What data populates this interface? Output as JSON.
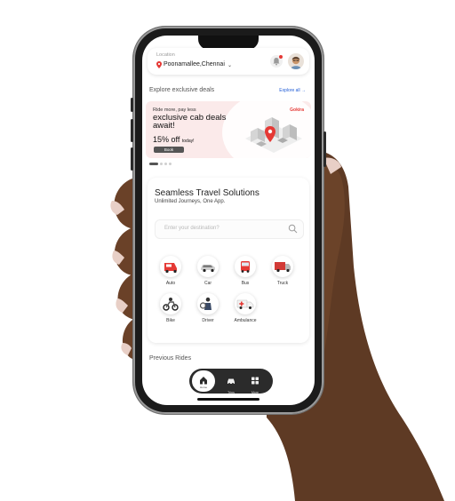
{
  "location": {
    "label": "Location",
    "name": "Poonamallee,Chennai"
  },
  "explore": {
    "title": "Explore exclusive deals",
    "link": "Explore all →"
  },
  "banner": {
    "subtitle": "Ride more, pay less",
    "title": "exclusive cab deals await!",
    "offer": "15% off",
    "offer_suffix": "today!",
    "button": "Book",
    "brand": "Gokira"
  },
  "card": {
    "title": "Seamless Travel Solutions",
    "subtitle": "Unlimited Journeys, One App.",
    "search_placeholder": "Enter your destination?"
  },
  "services": [
    {
      "label": "Auto",
      "icon": "auto-icon"
    },
    {
      "label": "Car",
      "icon": "car-icon"
    },
    {
      "label": "Bus",
      "icon": "bus-icon"
    },
    {
      "label": "Truck",
      "icon": "truck-icon"
    },
    {
      "label": "Bike",
      "icon": "bike-icon"
    },
    {
      "label": "Driver",
      "icon": "driver-icon"
    },
    {
      "label": "Ambulance",
      "icon": "ambulance-icon"
    }
  ],
  "previous_rides": "Previous Rides",
  "nav": {
    "home": "Home",
    "trips": "Trips",
    "more": "More"
  },
  "colors": {
    "accent": "#e53935",
    "nav_bg": "#2b2b2b",
    "link": "#1e5bd6",
    "banner_bg": "#fbeaea"
  }
}
